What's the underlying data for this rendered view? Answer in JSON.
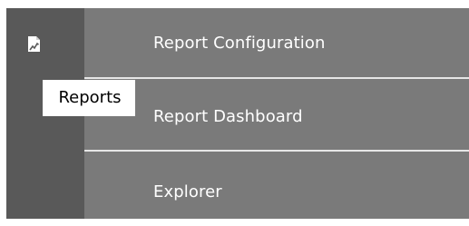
{
  "sidebar": {
    "icon": "report-document-icon",
    "tooltip": "Reports"
  },
  "menu": {
    "items": [
      {
        "label": "Report Configuration"
      },
      {
        "label": "Report Dashboard"
      },
      {
        "label": "Explorer"
      }
    ]
  },
  "colors": {
    "rail_background": "#595959",
    "menu_background": "#7a7a7a",
    "text": "#ffffff",
    "divider": "#e6e6e6",
    "tooltip_background": "#ffffff",
    "tooltip_text": "#000000"
  }
}
